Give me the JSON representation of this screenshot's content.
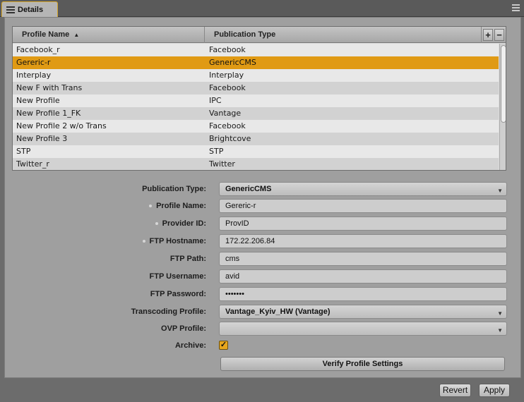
{
  "tab": {
    "title": "Details"
  },
  "table": {
    "headers": {
      "name": "Profile Name",
      "type": "Publication Type"
    },
    "sort_indicator": "▲",
    "add_label": "+",
    "remove_label": "−",
    "rows": [
      {
        "name": "Facebook_r",
        "type": "Facebook",
        "selected": false
      },
      {
        "name": "Gereric-r",
        "type": "GenericCMS",
        "selected": true
      },
      {
        "name": "Interplay",
        "type": "Interplay",
        "selected": false
      },
      {
        "name": "New F with Trans",
        "type": "Facebook",
        "selected": false
      },
      {
        "name": "New Profile",
        "type": "IPC",
        "selected": false
      },
      {
        "name": "New Profile 1_FK",
        "type": "Vantage",
        "selected": false
      },
      {
        "name": "New Profile 2 w/o Trans",
        "type": "Facebook",
        "selected": false
      },
      {
        "name": "New Profile 3",
        "type": "Brightcove",
        "selected": false
      },
      {
        "name": "STP",
        "type": "STP",
        "selected": false
      },
      {
        "name": "Twitter_r",
        "type": "Twitter",
        "selected": false
      }
    ]
  },
  "form": {
    "publication_type": {
      "label": "Publication Type:",
      "value": "GenericCMS"
    },
    "profile_name": {
      "label": "Profile Name:",
      "value": "Gereric-r"
    },
    "provider_id": {
      "label": "Provider ID:",
      "value": "ProvID"
    },
    "ftp_hostname": {
      "label": "FTP Hostname:",
      "value": "172.22.206.84"
    },
    "ftp_path": {
      "label": "FTP Path:",
      "value": "cms"
    },
    "ftp_username": {
      "label": "FTP Username:",
      "value": "avid"
    },
    "ftp_password": {
      "label": "FTP Password:",
      "value": "•••••••"
    },
    "transcoding_profile": {
      "label": "Transcoding Profile:",
      "value": "Vantage_Kyiv_HW (Vantage)"
    },
    "ovp_profile": {
      "label": "OVP Profile:",
      "value": ""
    },
    "archive": {
      "label": "Archive:",
      "checked": true,
      "check_glyph": "✓"
    },
    "verify_button": "Verify Profile Settings"
  },
  "footer": {
    "revert": "Revert",
    "apply": "Apply"
  },
  "colors": {
    "selection": "#e09a14",
    "tab_border": "#d7a72b",
    "checkbox": "#e6a51c"
  }
}
